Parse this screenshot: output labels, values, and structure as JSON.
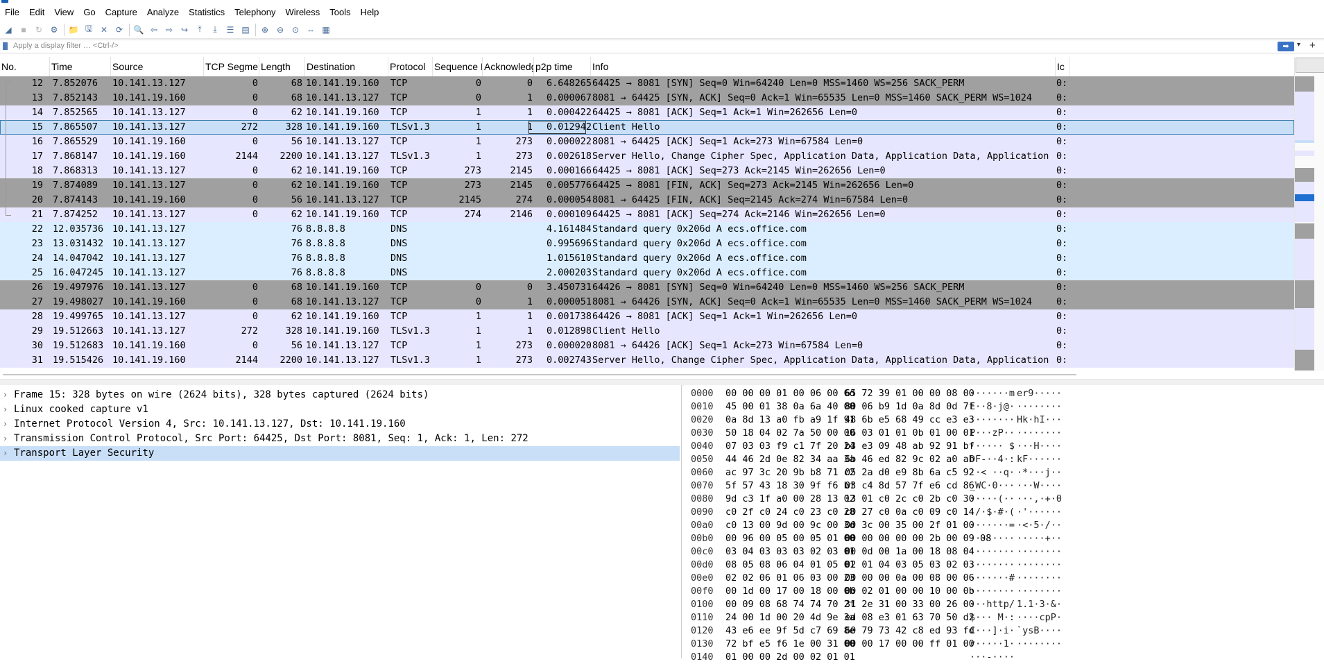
{
  "menu": [
    "File",
    "Edit",
    "View",
    "Go",
    "Capture",
    "Analyze",
    "Statistics",
    "Telephony",
    "Wireless",
    "Tools",
    "Help"
  ],
  "toolbar_icons": [
    "shark-fin-start-icon",
    "stop-icon",
    "restart-icon",
    "options-icon",
    "open-folder-icon",
    "save-icon",
    "close-file-icon",
    "reload-icon",
    "find-icon",
    "back-icon",
    "forward-icon",
    "go-to-icon",
    "first-icon",
    "last-icon",
    "autoscroll-icon",
    "colorize-icon",
    "zoom-in-icon",
    "zoom-out-icon",
    "zoom-reset-icon",
    "resize-columns-icon",
    "layout-icon"
  ],
  "filter": {
    "placeholder": "Apply a display filter … <Ctrl-/>"
  },
  "columns": [
    "No.",
    "Time",
    "Source",
    "TCP Segmen",
    "Length",
    "Destination",
    "Protocol",
    "Sequence N",
    "Acknowledg",
    "p2p time",
    "Info",
    "Ic"
  ],
  "colors": {
    "tcp_light": "#e7e6ff",
    "tcp_dark": "#a0a0a0",
    "dns": "#daeeff",
    "selected": "#c9dff8",
    "sel_border": "#3c7fb1"
  },
  "packets": [
    {
      "no": "12",
      "time": "7.852076",
      "src": "10.141.13.127",
      "seg": "0",
      "len": "68",
      "dst": "10.141.19.160",
      "proto": "TCP",
      "seq": "0",
      "ack": "0",
      "p2p": "6.648265",
      "info": "64425 → 8081 [SYN] Seq=0 Win=64240 Len=0 MSS=1460 WS=256 SACK_PERM",
      "ic": "0:",
      "color": "dark"
    },
    {
      "no": "13",
      "time": "7.852143",
      "src": "10.141.19.160",
      "seg": "0",
      "len": "68",
      "dst": "10.141.13.127",
      "proto": "TCP",
      "seq": "0",
      "ack": "1",
      "p2p": "0.000067",
      "info": "8081 → 64425 [SYN, ACK] Seq=0 Ack=1 Win=65535 Len=0 MSS=1460 SACK_PERM WS=1024",
      "ic": "0:",
      "color": "dark"
    },
    {
      "no": "14",
      "time": "7.852565",
      "src": "10.141.13.127",
      "seg": "0",
      "len": "62",
      "dst": "10.141.19.160",
      "proto": "TCP",
      "seq": "1",
      "ack": "1",
      "p2p": "0.000422",
      "info": "64425 → 8081 [ACK] Seq=1 Ack=1 Win=262656 Len=0",
      "ic": "0:",
      "color": "light"
    },
    {
      "no": "15",
      "time": "7.865507",
      "src": "10.141.13.127",
      "seg": "272",
      "len": "328",
      "dst": "10.141.19.160",
      "proto": "TLSv1.3",
      "seq": "1",
      "ack": "1",
      "p2p": "0.012942",
      "info": "Client Hello",
      "ic": "0:",
      "color": "selected"
    },
    {
      "no": "16",
      "time": "7.865529",
      "src": "10.141.19.160",
      "seg": "0",
      "len": "56",
      "dst": "10.141.13.127",
      "proto": "TCP",
      "seq": "1",
      "ack": "273",
      "p2p": "0.000022",
      "info": "8081 → 64425 [ACK] Seq=1 Ack=273 Win=67584 Len=0",
      "ic": "0:",
      "color": "light"
    },
    {
      "no": "17",
      "time": "7.868147",
      "src": "10.141.19.160",
      "seg": "2144",
      "len": "2200",
      "dst": "10.141.13.127",
      "proto": "TLSv1.3",
      "seq": "1",
      "ack": "273",
      "p2p": "0.002618",
      "info": "Server Hello, Change Cipher Spec, Application Data, Application Data, Application Data[Pac…",
      "ic": "0:",
      "color": "light"
    },
    {
      "no": "18",
      "time": "7.868313",
      "src": "10.141.13.127",
      "seg": "0",
      "len": "62",
      "dst": "10.141.19.160",
      "proto": "TCP",
      "seq": "273",
      "ack": "2145",
      "p2p": "0.000166",
      "info": "64425 → 8081 [ACK] Seq=273 Ack=2145 Win=262656 Len=0",
      "ic": "0:",
      "color": "light"
    },
    {
      "no": "19",
      "time": "7.874089",
      "src": "10.141.13.127",
      "seg": "0",
      "len": "62",
      "dst": "10.141.19.160",
      "proto": "TCP",
      "seq": "273",
      "ack": "2145",
      "p2p": "0.005776",
      "info": "64425 → 8081 [FIN, ACK] Seq=273 Ack=2145 Win=262656 Len=0",
      "ic": "0:",
      "color": "dark"
    },
    {
      "no": "20",
      "time": "7.874143",
      "src": "10.141.19.160",
      "seg": "0",
      "len": "56",
      "dst": "10.141.13.127",
      "proto": "TCP",
      "seq": "2145",
      "ack": "274",
      "p2p": "0.000054",
      "info": "8081 → 64425 [FIN, ACK] Seq=2145 Ack=274 Win=67584 Len=0",
      "ic": "0:",
      "color": "dark"
    },
    {
      "no": "21",
      "time": "7.874252",
      "src": "10.141.13.127",
      "seg": "0",
      "len": "62",
      "dst": "10.141.19.160",
      "proto": "TCP",
      "seq": "274",
      "ack": "2146",
      "p2p": "0.000109",
      "info": "64425 → 8081 [ACK] Seq=274 Ack=2146 Win=262656 Len=0",
      "ic": "0:",
      "color": "light"
    },
    {
      "no": "22",
      "time": "12.035736",
      "src": "10.141.13.127",
      "seg": "",
      "len": "76",
      "dst": "8.8.8.8",
      "proto": "DNS",
      "seq": "",
      "ack": "",
      "p2p": "4.161484",
      "info": "Standard query 0x206d A ecs.office.com",
      "ic": "0:",
      "color": "dns"
    },
    {
      "no": "23",
      "time": "13.031432",
      "src": "10.141.13.127",
      "seg": "",
      "len": "76",
      "dst": "8.8.8.8",
      "proto": "DNS",
      "seq": "",
      "ack": "",
      "p2p": "0.995696",
      "info": "Standard query 0x206d A ecs.office.com",
      "ic": "0:",
      "color": "dns"
    },
    {
      "no": "24",
      "time": "14.047042",
      "src": "10.141.13.127",
      "seg": "",
      "len": "76",
      "dst": "8.8.8.8",
      "proto": "DNS",
      "seq": "",
      "ack": "",
      "p2p": "1.015610",
      "info": "Standard query 0x206d A ecs.office.com",
      "ic": "0:",
      "color": "dns"
    },
    {
      "no": "25",
      "time": "16.047245",
      "src": "10.141.13.127",
      "seg": "",
      "len": "76",
      "dst": "8.8.8.8",
      "proto": "DNS",
      "seq": "",
      "ack": "",
      "p2p": "2.000203",
      "info": "Standard query 0x206d A ecs.office.com",
      "ic": "0:",
      "color": "dns"
    },
    {
      "no": "26",
      "time": "19.497976",
      "src": "10.141.13.127",
      "seg": "0",
      "len": "68",
      "dst": "10.141.19.160",
      "proto": "TCP",
      "seq": "0",
      "ack": "0",
      "p2p": "3.450731",
      "info": "64426 → 8081 [SYN] Seq=0 Win=64240 Len=0 MSS=1460 WS=256 SACK_PERM",
      "ic": "0:",
      "color": "dark"
    },
    {
      "no": "27",
      "time": "19.498027",
      "src": "10.141.19.160",
      "seg": "0",
      "len": "68",
      "dst": "10.141.13.127",
      "proto": "TCP",
      "seq": "0",
      "ack": "1",
      "p2p": "0.000051",
      "info": "8081 → 64426 [SYN, ACK] Seq=0 Ack=1 Win=65535 Len=0 MSS=1460 SACK_PERM WS=1024",
      "ic": "0:",
      "color": "dark"
    },
    {
      "no": "28",
      "time": "19.499765",
      "src": "10.141.13.127",
      "seg": "0",
      "len": "62",
      "dst": "10.141.19.160",
      "proto": "TCP",
      "seq": "1",
      "ack": "1",
      "p2p": "0.001738",
      "info": "64426 → 8081 [ACK] Seq=1 Ack=1 Win=262656 Len=0",
      "ic": "0:",
      "color": "light"
    },
    {
      "no": "29",
      "time": "19.512663",
      "src": "10.141.13.127",
      "seg": "272",
      "len": "328",
      "dst": "10.141.19.160",
      "proto": "TLSv1.3",
      "seq": "1",
      "ack": "1",
      "p2p": "0.012898",
      "info": "Client Hello",
      "ic": "0:",
      "color": "light"
    },
    {
      "no": "30",
      "time": "19.512683",
      "src": "10.141.19.160",
      "seg": "0",
      "len": "56",
      "dst": "10.141.13.127",
      "proto": "TCP",
      "seq": "1",
      "ack": "273",
      "p2p": "0.000020",
      "info": "8081 → 64426 [ACK] Seq=1 Ack=273 Win=67584 Len=0",
      "ic": "0:",
      "color": "light"
    },
    {
      "no": "31",
      "time": "19.515426",
      "src": "10.141.19.160",
      "seg": "2144",
      "len": "2200",
      "dst": "10.141.13.127",
      "proto": "TLSv1.3",
      "seq": "1",
      "ack": "273",
      "p2p": "0.002743",
      "info": "Server Hello, Change Cipher Spec, Application Data, Application Data, Application Data[Pac…",
      "ic": "0:",
      "color": "light"
    }
  ],
  "details": [
    {
      "text": "Frame 15: 328 bytes on wire (2624 bits), 328 bytes captured (2624 bits)",
      "selected": false
    },
    {
      "text": "Linux cooked capture v1",
      "selected": false
    },
    {
      "text": "Internet Protocol Version 4, Src: 10.141.13.127, Dst: 10.141.19.160",
      "selected": false
    },
    {
      "text": "Transmission Control Protocol, Src Port: 64425, Dst Port: 8081, Seq: 1, Ack: 1, Len: 272",
      "selected": false
    },
    {
      "text": "Transport Layer Security",
      "selected": true
    }
  ],
  "bytes": [
    {
      "off": "0000",
      "h1": "00 00 00 01 00 06 00 6d",
      "h2": "65 72 39 01 00 00 08 00",
      "a1": "·······m",
      "a2": "er9·····"
    },
    {
      "off": "0010",
      "h1": "45 00 01 38 0a 6a 40 00",
      "h2": "80 06 b9 1d 0a 8d 0d 7f",
      "a1": "E··8·j@·",
      "a2": "········"
    },
    {
      "off": "0020",
      "h1": "0a 8d 13 a0 fb a9 1f 91",
      "h2": "48 6b e5 68 49 cc e3 e3",
      "a1": "········",
      "a2": "Hk·hI···"
    },
    {
      "off": "0030",
      "h1": "50 18 04 02 7a 50 00 00",
      "h2": "16 03 01 01 0b 01 00 01",
      "a1": "P···zP··",
      "a2": "········"
    },
    {
      "off": "0040",
      "h1": "07 03 03 f9 c1 7f 20 24",
      "h2": "b3 e3 09 48 ab 92 91 bf",
      "a1": "······ $",
      "a2": "···H····"
    },
    {
      "off": "0050",
      "h1": "44 46 2d 0e 82 34 aa 3a",
      "h2": "6b 46 ed 82 9c 02 a0 ab",
      "a1": "DF-··4·:",
      "a2": "kF······"
    },
    {
      "off": "0060",
      "h1": "ac 97 3c 20 9b b8 71 c2",
      "h2": "05 2a d0 e9 8b 6a c5 92",
      "a1": "··< ··q·",
      "a2": "·*···j··"
    },
    {
      "off": "0070",
      "h1": "5f 57 43 18 30 9f f6 bf",
      "h2": "03 c4 8d 57 7f e6 cd 86",
      "a1": "_WC·0···",
      "a2": "···W····"
    },
    {
      "off": "0080",
      "h1": "9d c3 1f a0 00 28 13 02",
      "h2": "13 01 c0 2c c0 2b c0 30",
      "a1": "·····(··",
      "a2": "···,·+·0"
    },
    {
      "off": "0090",
      "h1": "c0 2f c0 24 c0 23 c0 28",
      "h2": "c0 27 c0 0a c0 09 c0 14",
      "a1": "·/·$·#·(",
      "a2": "·'······"
    },
    {
      "off": "00a0",
      "h1": "c0 13 00 9d 00 9c 00 3d",
      "h2": "00 3c 00 35 00 2f 01 00",
      "a1": "·······=",
      "a2": "·<·5·/··"
    },
    {
      "off": "00b0",
      "h1": "00 96 00 05 00 05 01 00",
      "h2": "00 00 00 00 00 2b 00 09 08",
      "a1": "········",
      "a2": "·····+··"
    },
    {
      "off": "00c0",
      "h1": "03 04 03 03 03 02 03 01",
      "h2": "00 0d 00 1a 00 18 08 04",
      "a1": "········",
      "a2": "········"
    },
    {
      "off": "00d0",
      "h1": "08 05 08 06 04 01 05 01",
      "h2": "02 01 04 03 05 03 02 03",
      "a1": "········",
      "a2": "········"
    },
    {
      "off": "00e0",
      "h1": "02 02 06 01 06 03 00 23",
      "h2": "00 00 00 0a 00 08 00 06",
      "a1": "·······#",
      "a2": "········"
    },
    {
      "off": "00f0",
      "h1": "00 1d 00 17 00 18 00 0b",
      "h2": "00 02 01 00 00 10 00 0b",
      "a1": "········",
      "a2": "········"
    },
    {
      "off": "0100",
      "h1": "00 09 08 68 74 74 70 2f",
      "h2": "31 2e 31 00 33 00 26 00",
      "a1": "···http/",
      "a2": "1.1·3·&·"
    },
    {
      "off": "0110",
      "h1": "24 00 1d 00 20 4d 9e 3a",
      "h2": "ed 08 e3 01 63 70 50 d2",
      "a1": "$··· M·:",
      "a2": "····cpP·"
    },
    {
      "off": "0120",
      "h1": "43 e6 ee 9f 5d c7 69 8e",
      "h2": "60 79 73 42 c8 ed 93 fd",
      "a1": "C···]·i·",
      "a2": "`ysB····"
    },
    {
      "off": "0130",
      "h1": "72 bf e5 f6 1e 00 31 00",
      "h2": "00 00 17 00 00 ff 01 00",
      "a1": "r·····1·",
      "a2": "········"
    },
    {
      "off": "0140",
      "h1": "01 00 00 2d 00 02 01 01",
      "h2": "",
      "a1": "···-····",
      "a2": ""
    }
  ]
}
